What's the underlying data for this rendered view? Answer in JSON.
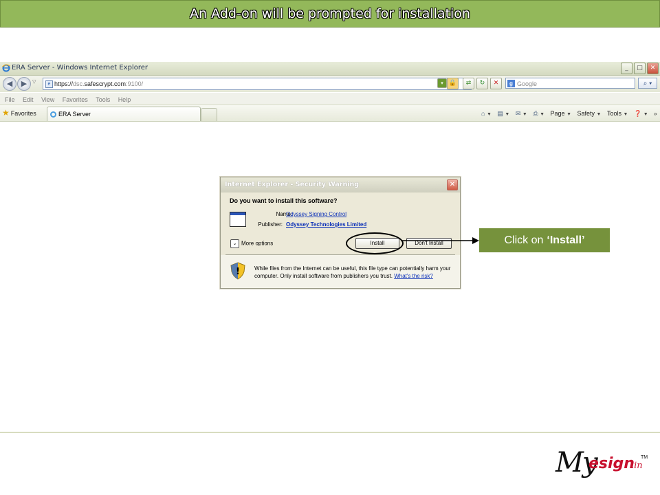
{
  "slide": {
    "title": "An Add-on will be prompted for installation"
  },
  "browser": {
    "window_title": "ERA Server - Windows Internet Explorer",
    "window_buttons": [
      "_",
      "□",
      "✕"
    ],
    "address": {
      "scheme": "https://",
      "host_prefix": "dsc.",
      "host_main": "safescrypt.com",
      "port_path": ":9100/"
    },
    "search_placeholder": "Google",
    "menu": [
      "File",
      "Edit",
      "View",
      "Favorites",
      "Tools",
      "Help"
    ],
    "favorites_label": "Favorites",
    "tab_title": "ERA Server",
    "command_bar": {
      "page": "Page",
      "safety": "Safety",
      "tools": "Tools"
    }
  },
  "dialog": {
    "title": "Internet Explorer - Security Warning",
    "question": "Do you want to install this software?",
    "name_label": "Name:",
    "name_value": "Odyssey Signing Control",
    "publisher_label": "Publisher:",
    "publisher_value": "Odyssey Technologies Limited",
    "more_options": "More options",
    "install_label": "Install",
    "dont_install_label": "Don't Install",
    "warning_text": "While files from the Internet can be useful, this file type can potentially harm your computer. Only install software from publishers you trust.",
    "warning_link": "What's the risk?"
  },
  "callout": {
    "prefix": "Click on",
    "target": "‘Install’"
  },
  "logo": {
    "part1": "My",
    "part2": "esign",
    "part3": ".in",
    "trademark": "TM"
  },
  "colors": {
    "banner": "#93b85a",
    "callout": "#76923c",
    "logo_red": "#c8102e",
    "link_blue": "#0a2fb8"
  }
}
